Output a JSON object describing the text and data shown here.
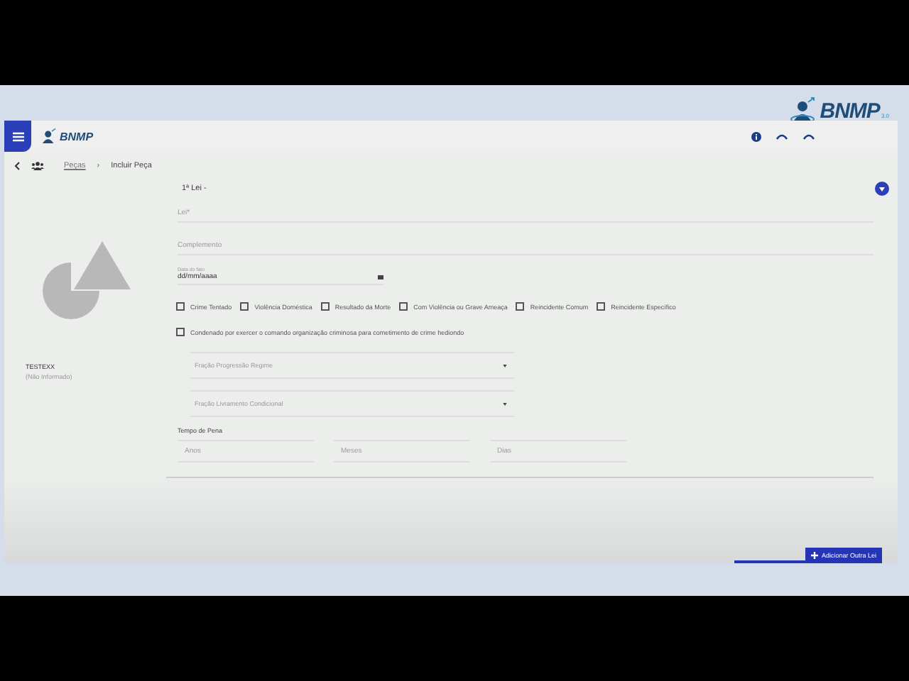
{
  "corner_logo": {
    "brand": "BNMP",
    "version": "3.0"
  },
  "header": {
    "brand": "BNMP"
  },
  "breadcrumb": {
    "link": "Peças",
    "separator": "›",
    "current": "Incluir Peça"
  },
  "person": {
    "name": "TESTEXX",
    "detail": "(Não Informado)"
  },
  "law": {
    "title": "1ª Lei -"
  },
  "fields": {
    "lei": {
      "placeholder": "Lei*"
    },
    "complemento": {
      "placeholder": "Complemento"
    },
    "date": {
      "label": "Data do fato",
      "value": "dd/mm/aaaa"
    }
  },
  "checkboxes": [
    {
      "label": "Crime Tentado",
      "checked": false
    },
    {
      "label": "Violência Doméstica",
      "checked": false
    },
    {
      "label": "Resultado da Morte",
      "checked": false
    },
    {
      "label": "Com Violência ou Grave Ameaça",
      "checked": false
    },
    {
      "label": "Reincidente Comum",
      "checked": false
    },
    {
      "label": "Reincidente Específico",
      "checked": false
    }
  ],
  "wide_checkbox": {
    "label": "Condenado por exercer o comando organização criminosa para cometimento de crime hediondo",
    "checked": false
  },
  "selects": [
    {
      "placeholder": "Fração Progressão Regime"
    },
    {
      "placeholder": "Fração Livramento Condicional"
    }
  ],
  "sentence": {
    "label": "Tempo de Pena",
    "fields": [
      {
        "placeholder": "Anos"
      },
      {
        "placeholder": "Meses"
      },
      {
        "placeholder": "Dias"
      }
    ]
  },
  "add_button": {
    "label": "Adicionar Outra Lei"
  }
}
